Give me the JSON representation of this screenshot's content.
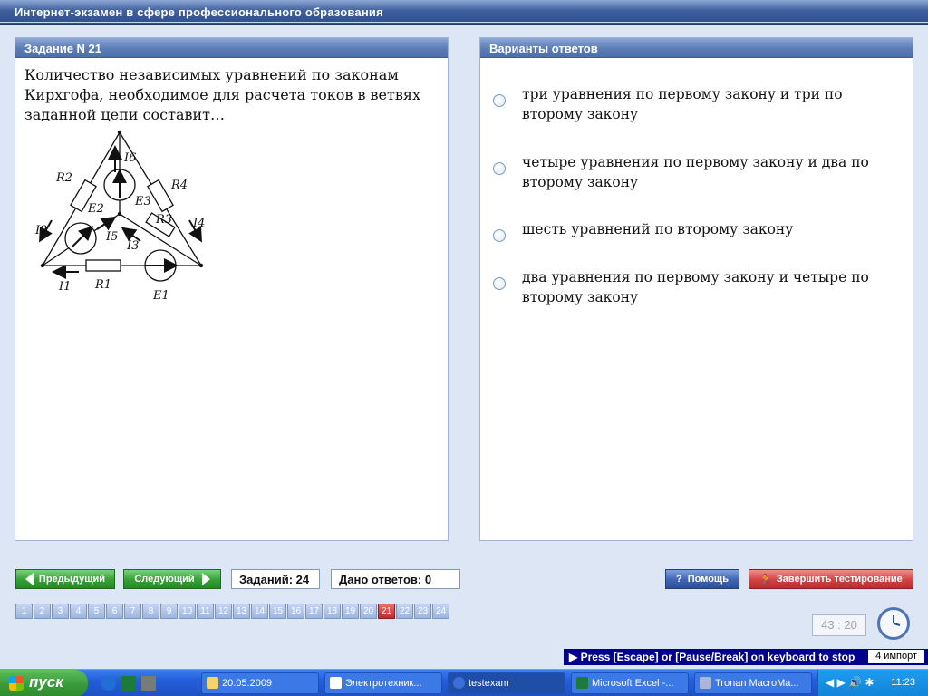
{
  "window": {
    "title": "Интернет-экзамен в сфере профессионального образования"
  },
  "task": {
    "header": "Задание N 21",
    "question": "Количество независимых уравнений по законам Кирхгофа, необходимое для расчета токов в ветвях заданной цепи составит…",
    "diagram": {
      "labels": [
        "R2",
        "I6",
        "R4",
        "E3",
        "E2",
        "R3",
        "I4",
        "I2",
        "I5",
        "I3",
        "I1",
        "R1",
        "E1"
      ]
    }
  },
  "answers": {
    "header": "Варианты ответов",
    "items": [
      {
        "text": "три уравнения по первому закону и три по второму закону"
      },
      {
        "text": "четыре уравнения по первому закону и два по второму закону"
      },
      {
        "text": "шесть уравнений по второму закону"
      },
      {
        "text": "два уравнения по первому закону и четыре по второму закону"
      }
    ]
  },
  "nav": {
    "prev_label": "Предыдущий",
    "next_label": "Следующий",
    "total_label": "Заданий: 24",
    "answered_label": "Дано ответов: 0",
    "help_label": "Помощь",
    "finish_label": "Завершить тестирование",
    "pages": [
      "1",
      "2",
      "3",
      "4",
      "5",
      "6",
      "7",
      "8",
      "9",
      "10",
      "11",
      "12",
      "13",
      "14",
      "15",
      "16",
      "17",
      "18",
      "19",
      "20",
      "21",
      "22",
      "23",
      "24"
    ],
    "current_page": "21"
  },
  "timer": {
    "value": "43 : 20"
  },
  "escape_bar": {
    "text": "Press [Escape] or [Pause/Break] on keyboard to stop",
    "label": "4 импорт"
  },
  "taskbar": {
    "start_label": "пуск",
    "items": [
      {
        "label": "20.05.2009",
        "icon": "folder-icon"
      },
      {
        "label": "Электротехник...",
        "icon": "word-icon"
      },
      {
        "label": "testexam",
        "icon": "app-icon"
      },
      {
        "label": "Microsoft Excel -...",
        "icon": "excel-icon"
      },
      {
        "label": "Tronan MacroMa...",
        "icon": "play-icon"
      }
    ],
    "clock": "11:23"
  },
  "colors": {
    "title_blue": "#3d5e9e",
    "panel_head": "#5b7cb8",
    "green": "#35a035",
    "red": "#d24242",
    "active_page": "#c42b2b"
  }
}
